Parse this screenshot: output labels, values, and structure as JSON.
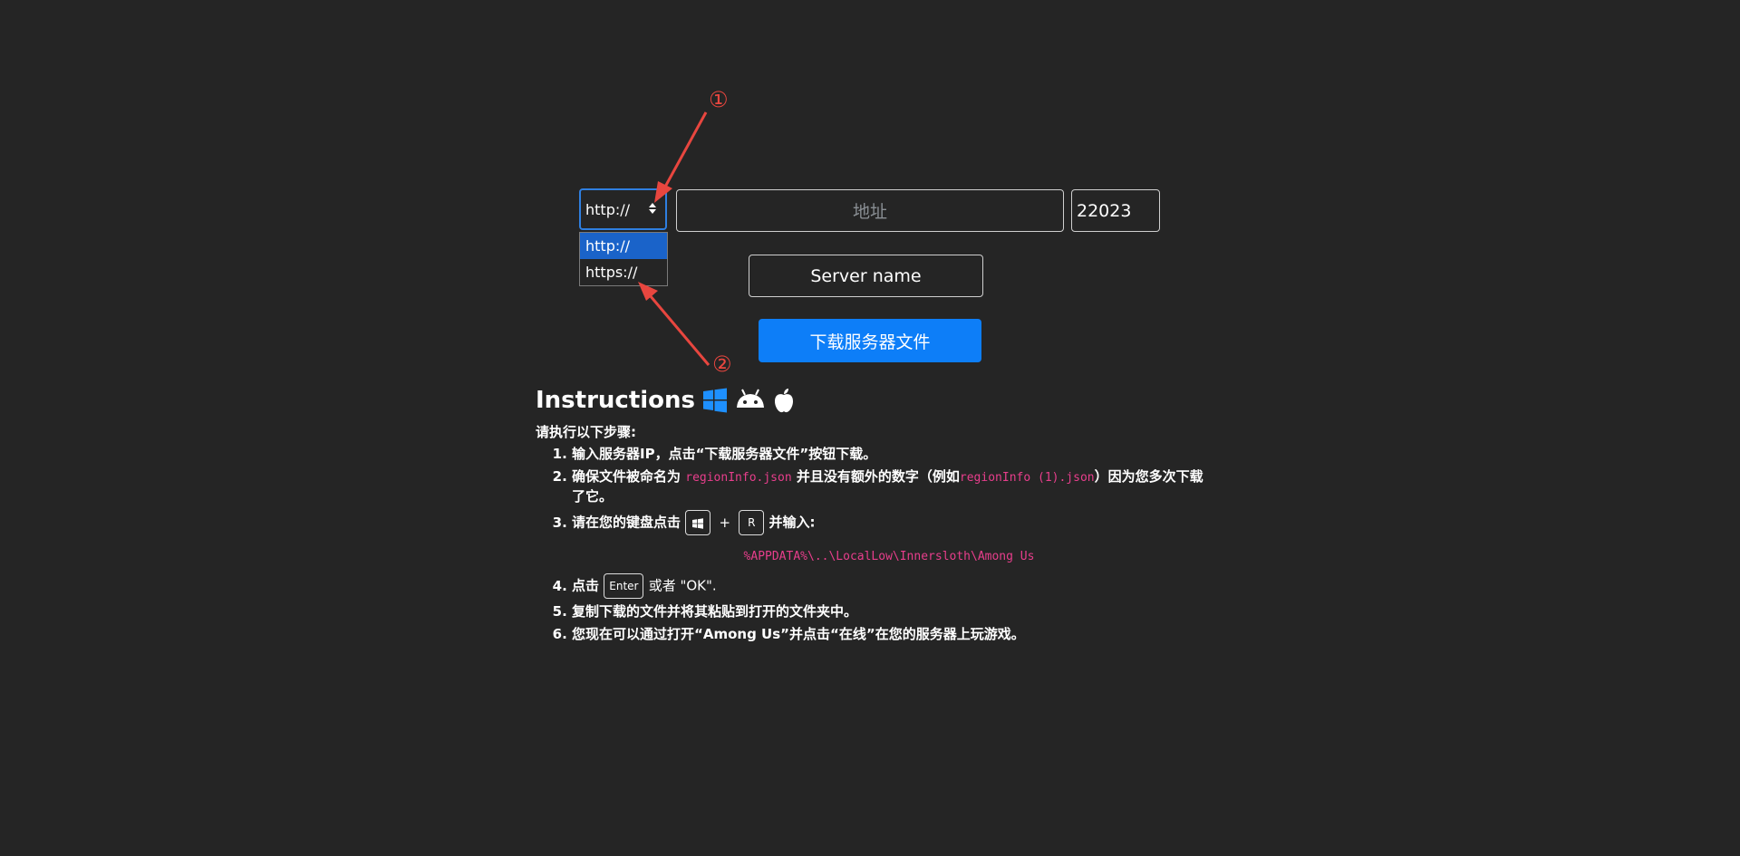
{
  "form": {
    "protocol_selected": "http://",
    "protocol_options": [
      "http://",
      "https://"
    ],
    "address_placeholder": "地址",
    "port_value": "22023",
    "server_name_placeholder": "Server name",
    "download_button": "下载服务器文件"
  },
  "annotations": {
    "marker_1": "①",
    "marker_2": "②",
    "color": "#e8463f"
  },
  "instructions": {
    "title": "Instructions",
    "os_icons": [
      "windows-icon",
      "android-icon",
      "apple-icon"
    ],
    "lead": "请执行以下步骤:",
    "step1": "输入服务器IP，点击“下载服务器文件”按钮下载。",
    "step2_a": "确保文件被命名为",
    "step2_code1": "regionInfo.json",
    "step2_b": "并且没有额外的数字（例如",
    "step2_code2": "regionInfo (1).json",
    "step2_c": "）因为您多次下载了它。",
    "step3_a": "请在您的键盘点击",
    "step3_key_plus": "+",
    "step3_key_r": "R",
    "step3_b": "并输入:",
    "path": "%APPDATA%\\..\\LocalLow\\Innersloth\\Among Us",
    "step4_a": "点击",
    "step4_key": "Enter",
    "step4_b": "或者 \"OK\".",
    "step5": "复制下载的文件并将其粘贴到打开的文件夹中。",
    "step6": "您现在可以通过打开“Among Us”并点击“在线”在您的服务器上玩游戏。"
  },
  "colors": {
    "background": "#252525",
    "primary": "#0d7ef8",
    "code": "#e83e8c",
    "windows_blue": "#1e90ff"
  }
}
